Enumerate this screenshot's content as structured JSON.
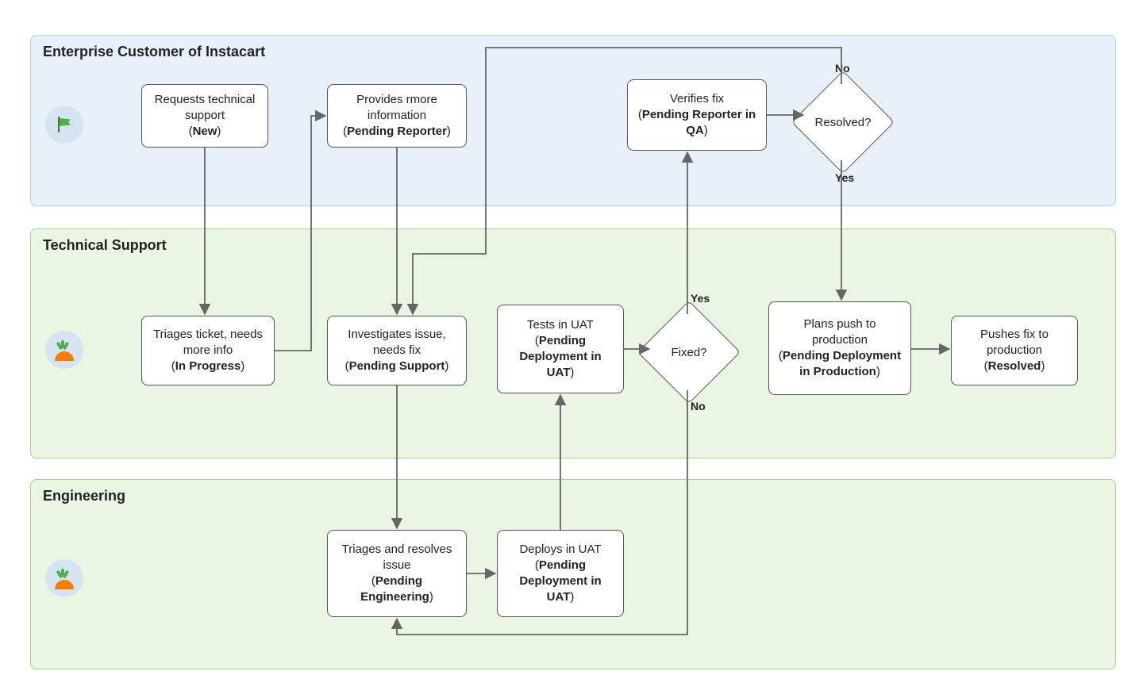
{
  "lanes": {
    "customer": {
      "title": "Enterprise Customer of Instacart"
    },
    "support": {
      "title": "Technical Support"
    },
    "engineering": {
      "title": "Engineering"
    }
  },
  "nodes": {
    "requests": {
      "text": "Requests technical support",
      "status": "New"
    },
    "provides": {
      "text": "Provides rmore information",
      "status": "Pending Reporter"
    },
    "verifies": {
      "text": "Verifies fix",
      "status": "Pending Reporter in QA"
    },
    "triage_info": {
      "text": "Triages ticket, needs more info",
      "status": "In Progress"
    },
    "investigate": {
      "text": "Investigates issue, needs fix",
      "status": "Pending Support"
    },
    "tests_uat": {
      "text": "Tests in UAT",
      "status": "Pending Deployment in UAT"
    },
    "plan_prod": {
      "text": "Plans push to production",
      "status": "Pending Deployment in Production"
    },
    "push_prod": {
      "text": "Pushes fix to production",
      "status": "Resolved"
    },
    "eng_triage": {
      "text": "Triages and resolves issue",
      "status": "Pending Engineering"
    },
    "eng_deploy": {
      "text": "Deploys in UAT",
      "status": "Pending Deployment in UAT"
    }
  },
  "decisions": {
    "fixed": {
      "label": "Fixed?",
      "yes": "Yes",
      "no": "No"
    },
    "resolved": {
      "label": "Resolved?",
      "yes": "Yes",
      "no": "No"
    }
  },
  "chart_data": {
    "type": "flowchart-swimlane",
    "swimlanes": [
      {
        "id": "customer",
        "title": "Enterprise Customer of Instacart"
      },
      {
        "id": "support",
        "title": "Technical Support"
      },
      {
        "id": "engineering",
        "title": "Engineering"
      }
    ],
    "nodes": [
      {
        "id": "requests",
        "lane": "customer",
        "type": "process",
        "label": "Requests technical support",
        "status": "New"
      },
      {
        "id": "provides",
        "lane": "customer",
        "type": "process",
        "label": "Provides rmore information",
        "status": "Pending Reporter"
      },
      {
        "id": "verifies",
        "lane": "customer",
        "type": "process",
        "label": "Verifies fix",
        "status": "Pending Reporter in QA"
      },
      {
        "id": "resolved_dec",
        "lane": "customer",
        "type": "decision",
        "label": "Resolved?"
      },
      {
        "id": "triage_info",
        "lane": "support",
        "type": "process",
        "label": "Triages ticket, needs more info",
        "status": "In Progress"
      },
      {
        "id": "investigate",
        "lane": "support",
        "type": "process",
        "label": "Investigates issue, needs fix",
        "status": "Pending Support"
      },
      {
        "id": "tests_uat",
        "lane": "support",
        "type": "process",
        "label": "Tests in UAT",
        "status": "Pending Deployment in UAT"
      },
      {
        "id": "fixed_dec",
        "lane": "support",
        "type": "decision",
        "label": "Fixed?"
      },
      {
        "id": "plan_prod",
        "lane": "support",
        "type": "process",
        "label": "Plans push to production",
        "status": "Pending Deployment in Production"
      },
      {
        "id": "push_prod",
        "lane": "support",
        "type": "process",
        "label": "Pushes fix to production",
        "status": "Resolved"
      },
      {
        "id": "eng_triage",
        "lane": "engineering",
        "type": "process",
        "label": "Triages and resolves issue",
        "status": "Pending Engineering"
      },
      {
        "id": "eng_deploy",
        "lane": "engineering",
        "type": "process",
        "label": "Deploys in UAT",
        "status": "Pending Deployment in UAT"
      }
    ],
    "edges": [
      {
        "from": "requests",
        "to": "triage_info"
      },
      {
        "from": "triage_info",
        "to": "provides"
      },
      {
        "from": "provides",
        "to": "investigate"
      },
      {
        "from": "investigate",
        "to": "eng_triage"
      },
      {
        "from": "eng_triage",
        "to": "eng_deploy"
      },
      {
        "from": "eng_deploy",
        "to": "tests_uat"
      },
      {
        "from": "tests_uat",
        "to": "fixed_dec"
      },
      {
        "from": "fixed_dec",
        "to": "verifies",
        "label": "Yes"
      },
      {
        "from": "fixed_dec",
        "to": "eng_triage",
        "label": "No"
      },
      {
        "from": "verifies",
        "to": "resolved_dec"
      },
      {
        "from": "resolved_dec",
        "to": "plan_prod",
        "label": "Yes"
      },
      {
        "from": "resolved_dec",
        "to": "investigate",
        "label": "No"
      },
      {
        "from": "plan_prod",
        "to": "push_prod"
      }
    ]
  }
}
